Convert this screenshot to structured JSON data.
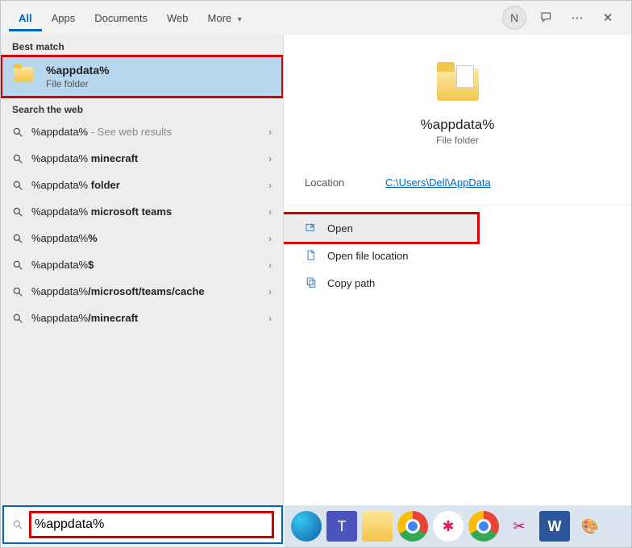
{
  "tabs": {
    "all": "All",
    "apps": "Apps",
    "documents": "Documents",
    "web": "Web",
    "more": "More"
  },
  "avatar_letter": "N",
  "sections": {
    "best_match": "Best match",
    "search_web": "Search the web"
  },
  "best": {
    "title": "%appdata%",
    "subtitle": "File folder"
  },
  "web_results": [
    {
      "prefix": "%appdata%",
      "bold": "",
      "hint": " - See web results"
    },
    {
      "prefix": "%appdata% ",
      "bold": "minecraft",
      "hint": ""
    },
    {
      "prefix": "%appdata% ",
      "bold": "folder",
      "hint": ""
    },
    {
      "prefix": "%appdata% ",
      "bold": "microsoft teams",
      "hint": ""
    },
    {
      "prefix": "%appdata%",
      "bold": "%",
      "hint": ""
    },
    {
      "prefix": "%appdata%",
      "bold": "$",
      "hint": ""
    },
    {
      "prefix": "%appdata%",
      "bold": "/microsoft/teams/cache",
      "hint": ""
    },
    {
      "prefix": "%appdata%",
      "bold": "/minecraft",
      "hint": ""
    }
  ],
  "preview": {
    "title": "%appdata%",
    "subtitle": "File folder",
    "location_label": "Location",
    "location_value": "C:\\Users\\Dell\\AppData"
  },
  "actions": {
    "open": "Open",
    "open_loc": "Open file location",
    "copy_path": "Copy path"
  },
  "search_value": "%appdata%",
  "taskbar_icons": [
    "edge",
    "teams",
    "explorer",
    "chrome",
    "slack",
    "chrome2",
    "snip",
    "word",
    "paint"
  ]
}
